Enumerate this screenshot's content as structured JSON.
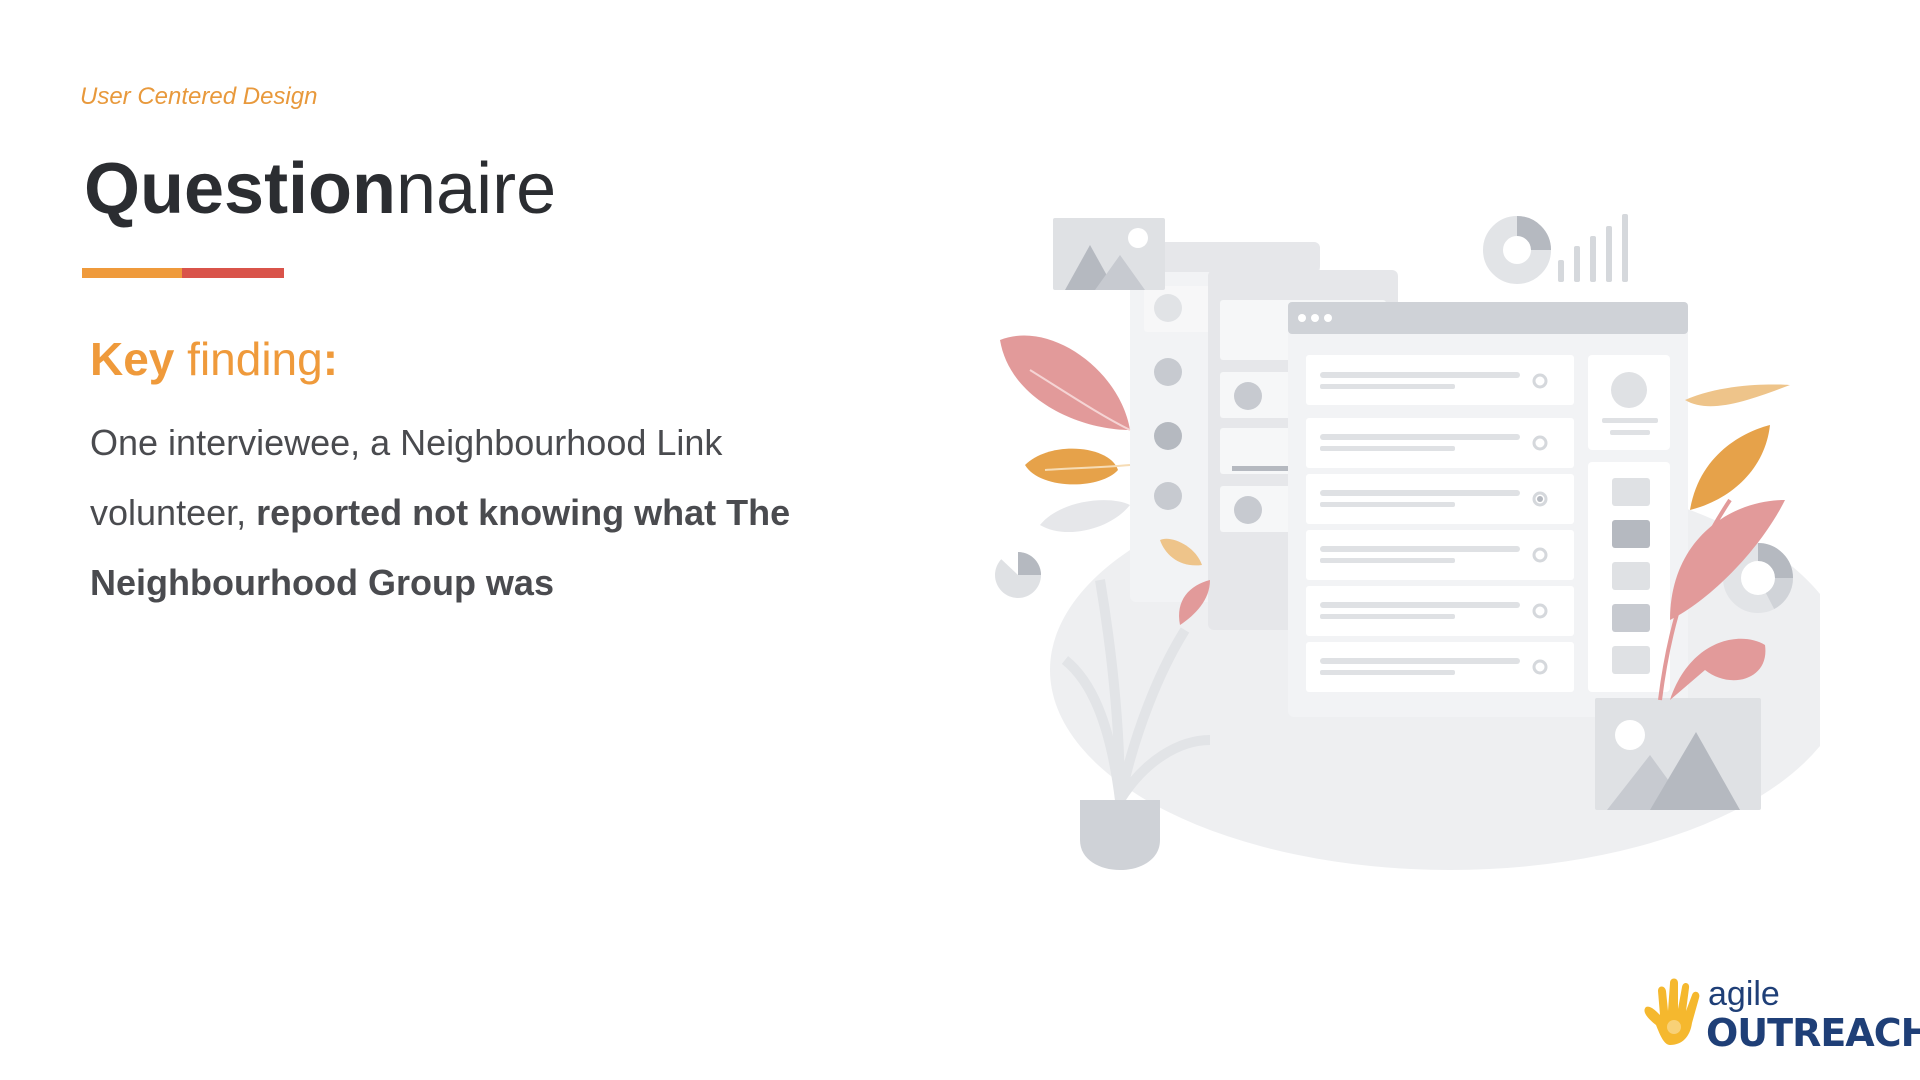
{
  "slide": {
    "section_label": "User Centered Design",
    "title_bold": "Question",
    "title_light": "naire",
    "key_finding": {
      "keyword": "Key",
      "rest": " finding",
      "colon": ":"
    },
    "body": {
      "intro": "One interviewee, a Neighbourhood Link volunteer, ",
      "emphasis": "reported not knowing what The Neighbourhood Group was"
    }
  },
  "logo": {
    "top_word": "agile",
    "bottom_word": "OUTREACH"
  },
  "colors": {
    "accent_orange": "#e8993c",
    "accent_red": "#d9534a",
    "title_dark": "#2b2d31",
    "body_gray": "#4a4b4f",
    "logo_navy": "#1f3f77",
    "logo_yellow": "#f5b82e"
  },
  "icons": [
    "hand-logo-icon",
    "ui-illustration"
  ]
}
